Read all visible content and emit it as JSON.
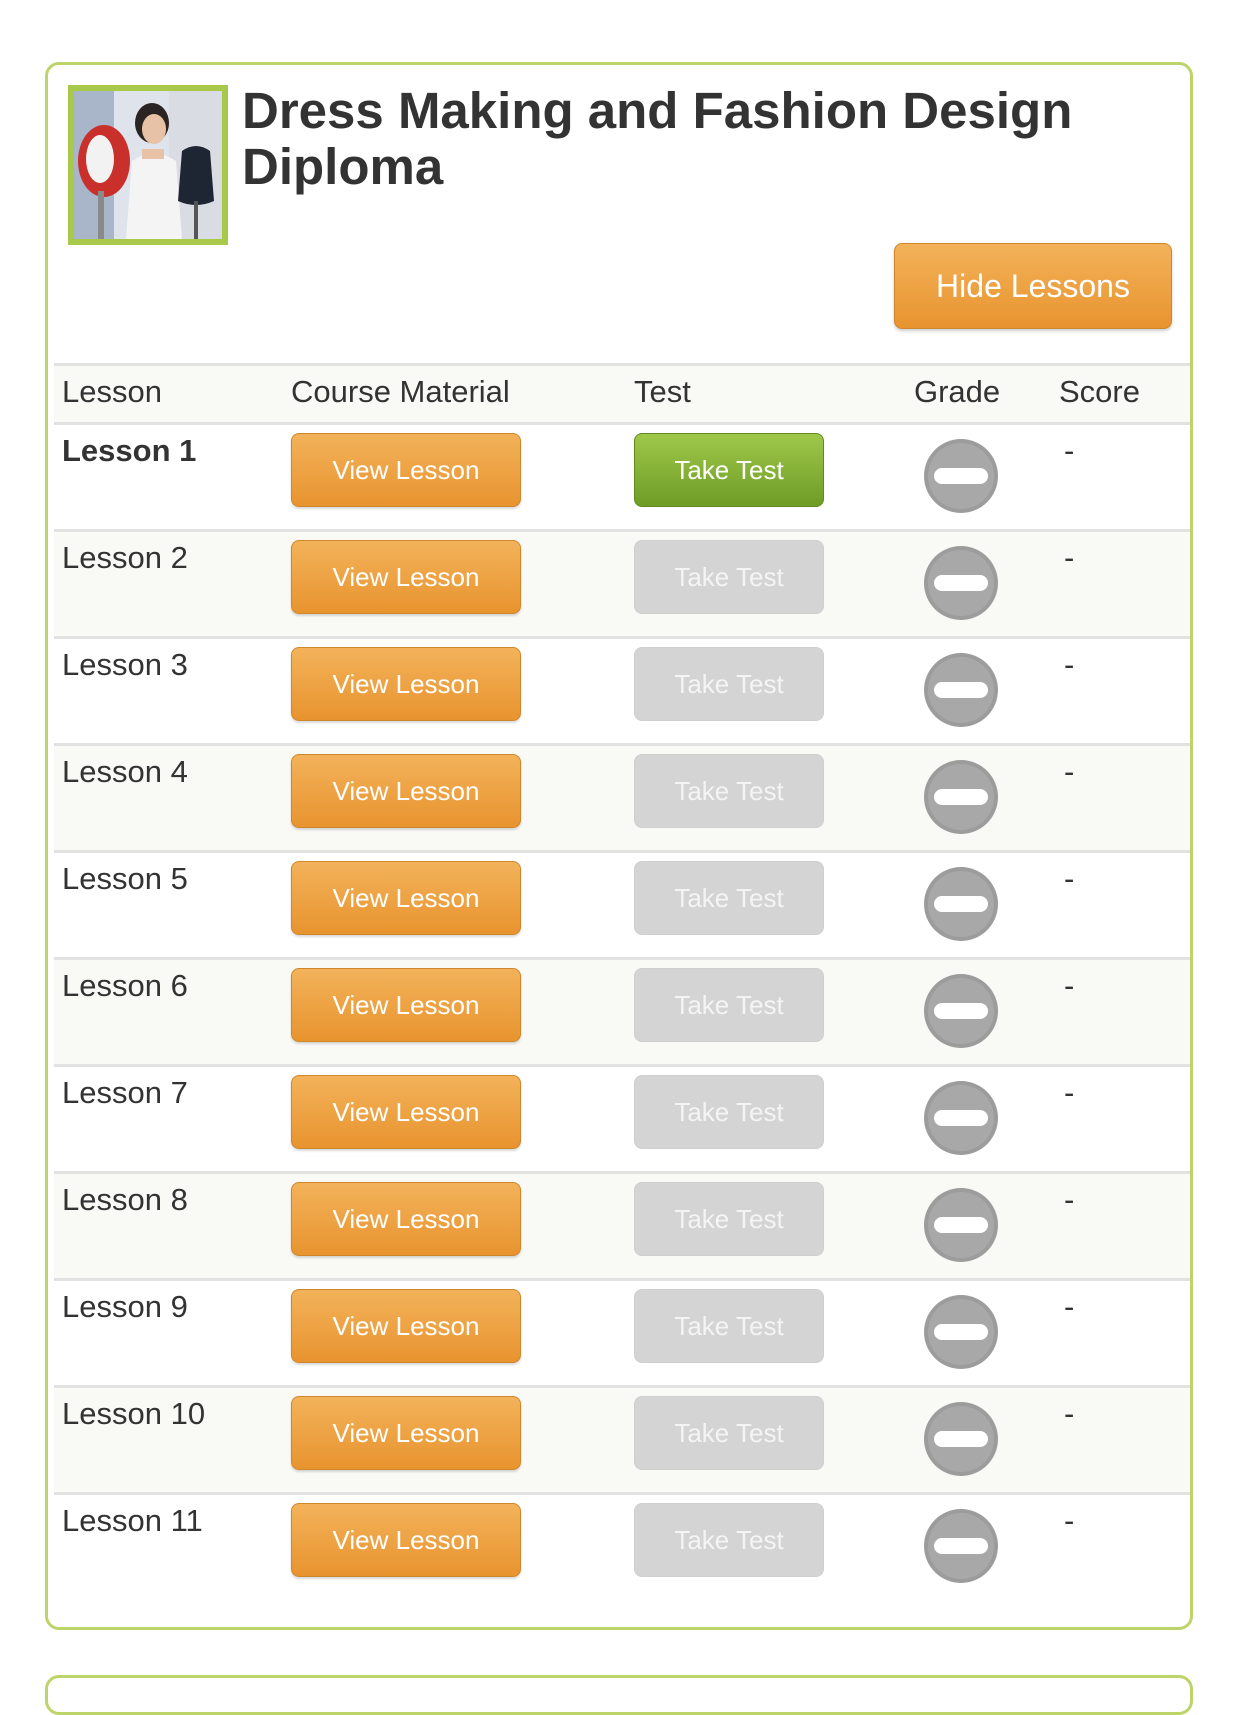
{
  "course": {
    "title": "Dress Making and Fashion Design Diploma",
    "hide_label": "Hide Lessons"
  },
  "table": {
    "headers": {
      "lesson": "Lesson",
      "material": "Course Material",
      "test": "Test",
      "grade": "Grade",
      "score": "Score"
    },
    "rows": [
      {
        "lesson": "Lesson 1",
        "view": "View Lesson",
        "test": "Take Test",
        "score": "-"
      },
      {
        "lesson": "Lesson 2",
        "view": "View Lesson",
        "test": "Take Test",
        "score": "-"
      },
      {
        "lesson": "Lesson 3",
        "view": "View Lesson",
        "test": "Take Test",
        "score": "-"
      },
      {
        "lesson": "Lesson 4",
        "view": "View Lesson",
        "test": "Take Test",
        "score": "-"
      },
      {
        "lesson": "Lesson 5",
        "view": "View Lesson",
        "test": "Take Test",
        "score": "-"
      },
      {
        "lesson": "Lesson 6",
        "view": "View Lesson",
        "test": "Take Test",
        "score": "-"
      },
      {
        "lesson": "Lesson 7",
        "view": "View Lesson",
        "test": "Take Test",
        "score": "-"
      },
      {
        "lesson": "Lesson 8",
        "view": "View Lesson",
        "test": "Take Test",
        "score": "-"
      },
      {
        "lesson": "Lesson 9",
        "view": "View Lesson",
        "test": "Take Test",
        "score": "-"
      },
      {
        "lesson": "Lesson 10",
        "view": "View Lesson",
        "test": "Take Test",
        "score": "-"
      },
      {
        "lesson": "Lesson 11",
        "view": "View Lesson",
        "test": "Take Test",
        "score": "-"
      }
    ]
  },
  "colors": {
    "accent_orange": "#e8942f",
    "accent_green": "#6e9c26",
    "border_green": "#bdd46a",
    "disabled_gray": "#d4d4d4"
  },
  "icons": {
    "grade": "no-entry-icon"
  }
}
